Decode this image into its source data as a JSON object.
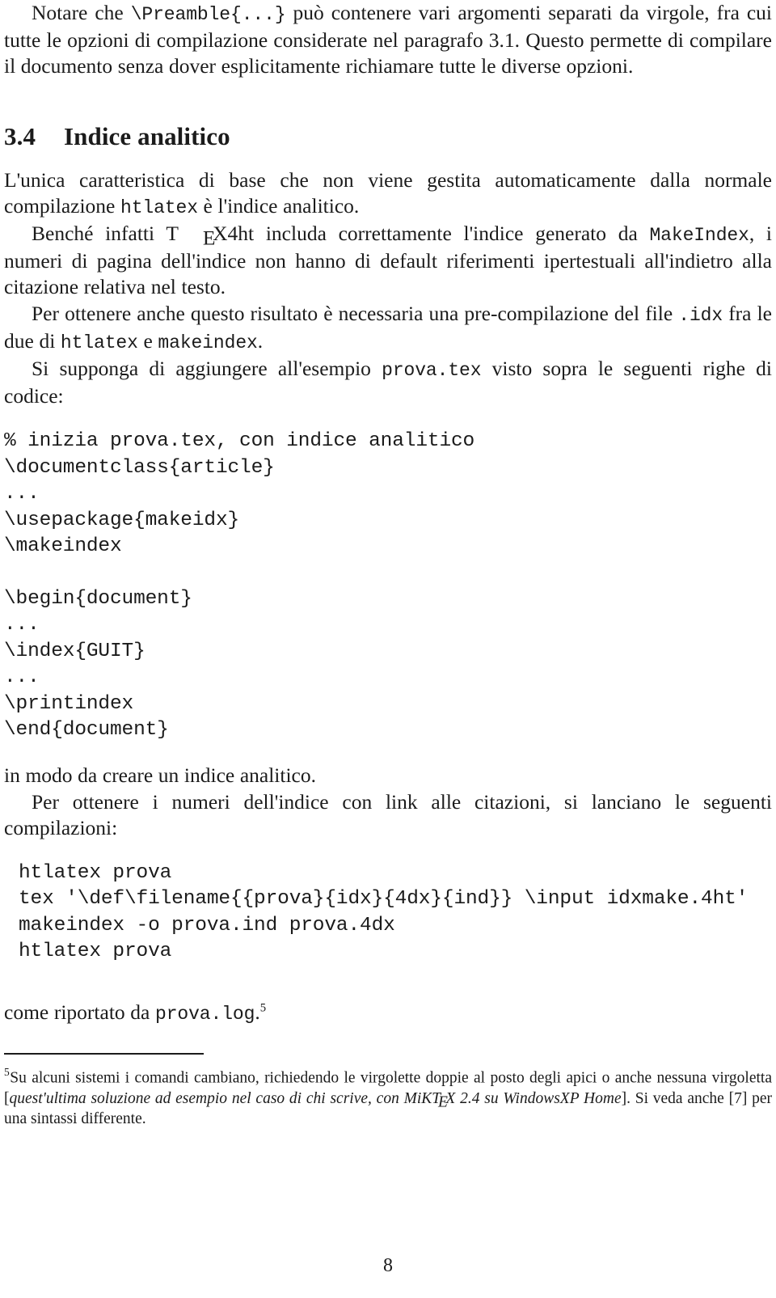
{
  "page": {
    "number": "8"
  },
  "paragraphs": {
    "p1_a": "Notare che ",
    "p1_code": "\\Preamble{...}",
    "p1_b": " può contenere vari argomenti separati da virgole, fra cui tutte le opzioni di compilazione considerate nel paragrafo 3.1. Questo permette di compilare il documento senza dover esplicitamente richiamare tutte le diverse opzioni."
  },
  "section": {
    "number": "3.4",
    "title": "Indice analitico"
  },
  "p2": {
    "a": "L'unica caratteristica di base che non viene gestita automaticamente dalla normale compilazione ",
    "code1": "htlatex",
    "b": " è l'indice analitico."
  },
  "p3": {
    "a": "Benché infatti ",
    "logo_t": "T",
    "logo_e": "E",
    "logo_x": "X",
    "logo_suffix": "4ht",
    "b": " includa correttamente l'indice generato da ",
    "code1": "MakeIndex",
    "c": ", i numeri di pagina dell'indice non hanno di default riferimenti ipertestuali all'indietro alla citazione relativa nel testo."
  },
  "p4": {
    "a": "Per ottenere anche questo risultato è necessaria una pre-compilazione del file ",
    "code1": ".idx",
    "b": " fra le due di ",
    "code2": "htlatex",
    "c": " e ",
    "code3": "makeindex",
    "d": "."
  },
  "p5": {
    "a": "Si supponga di aggiungere all'esempio ",
    "code1": "prova.tex",
    "b": " visto sopra le seguenti righe di codice:"
  },
  "code_block_1": "% inizia prova.tex, con indice analitico\n\\documentclass{article}\n...\n\\usepackage{makeidx}\n\\makeindex\n\n\\begin{document}\n...\n\\index{GUIT}\n...\n\\printindex\n\\end{document}",
  "p6": {
    "text": "in modo da creare un indice analitico."
  },
  "p7": {
    "text": "Per ottenere i numeri dell'indice con link alle citazioni, si lanciano le seguenti compilazioni:"
  },
  "code_block_2": "htlatex prova\ntex '\\def\\filename{{prova}{idx}{4dx}{ind}} \\input idxmake.4ht'\nmakeindex -o prova.ind prova.4dx\nhtlatex prova",
  "p8": {
    "a": "come riportato da ",
    "code1": "prova.log",
    "b": ".",
    "fnref": "5"
  },
  "footnote": {
    "mark": "5",
    "a": "Su alcuni sistemi i comandi cambiano, richiedendo le virgolette doppie al posto degli apici o anche nessuna virgoletta [",
    "italic_a": "quest'ultima soluzione ad esempio nel caso di chi scrive, con ",
    "italic_logo_mi": "MiK",
    "italic_logo_t": "T",
    "italic_logo_e": "E",
    "italic_logo_x": "X",
    "italic_b": " 2.4 su WindowsXP Home",
    "b": "]. Si veda anche [7] per una sintassi differente."
  }
}
